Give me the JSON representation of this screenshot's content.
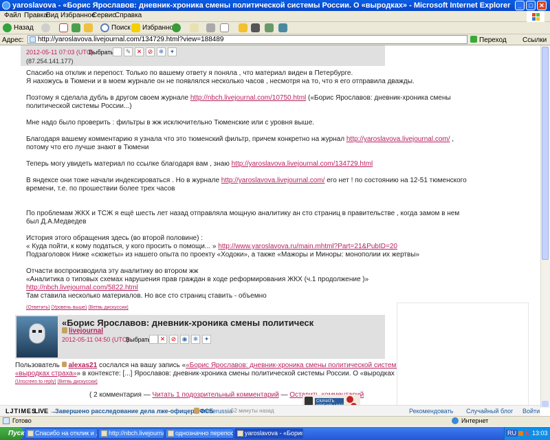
{
  "window": {
    "title": "yaroslavova - «Борис Ярославов: дневник-хроника смены политической системы России. О «выродках» - Microsoft Internet Explorer"
  },
  "menu": [
    "Файл",
    "Правка",
    "Вид",
    "Избранное",
    "Сервис",
    "Справка"
  ],
  "toolbar": {
    "back": "Назад",
    "search": "Поиск",
    "favorites": "Избранное"
  },
  "address": {
    "label": "Адрес:",
    "url": "http://yaroslavova.livejournal.com/134729.html?view=188489",
    "go": "Переход",
    "links": "Ссылки"
  },
  "comment1": {
    "date": "2012-05-11 07:03 (UTC)",
    "select_label": "Выбрать:",
    "ip": "(87.254.141.177)",
    "lines": [
      "Спасибо на отклик и перепост. Только по вашему ответу я поняла , что материал виден в Петербурге.",
      "Я нахожусь в Тюмени и в моем журнале он не появлялся несколько часов , несмотря на то, что я его отправила дважды.",
      "",
      "Поэтому я сделала дубль в другом своем журнале",
      "политической системы России...)",
      "",
      "Мне надо было проверить : фильтры в жж исключительно Тюменские или с уровня выше.",
      "",
      "Благодаря вашему комментарию я узнала что это тюменский фильтр, причем конкретно на журнал",
      "потому что его лучше знают в Тюмени",
      "",
      "Теперь могу увидеть материал по ссылке благодаря вам , знаю",
      "",
      "В яндексе они тоже начали индексироваться . Но в журнале",
      "времени, т.е. по прошествии более трех часов",
      "",
      "",
      "По проблемам ЖКХ и ТСЖ я ещё шесть лет назад отправляла мощную аналитику ан сто страниц в правительстве , когда замом в нем",
      "был Д.А.Медведев",
      "",
      "История этого обращения здесь (во второй половине) :",
      "« Куда пойти, к кому податься, у кого просить о помощи... »",
      "Подзаголовок Ниже «сюжеты» из нашего опыта по проекту «Ходоки», а также «Мажоры и Миноры: монополии их жертвы»",
      "",
      "Отчасти воспроизводила эту аналитику во втором жж",
      "«Аналитика о типовых схемах нарушения прав граждан в ходе реформирования ЖКХ (ч.1 продолжение )»",
      "",
      "Там ставила несколько материалов. Но все сто страниц ставить - объемно"
    ],
    "link_nbch": "http://nbch.livejournal.com/10750.html",
    "after_nbch": "(«Борис Ярославов: дневник-хроника смены",
    "link_yar": "http://yaroslavova.livejournal.com/",
    "after_yar": ",",
    "link_134729": "http://yaroslavova.livejournal.com/134729.html",
    "link_yar2": "http://yaroslavova.livejournal.com/",
    "after_yar2": "его нет ! по состоянию на 12-51 тюменского",
    "link_main": "http://www.yaroslavova.ru/main.mhtml?Part=21&PubID=20",
    "link_5822": "http://nbch.livejournal.com/5822.html",
    "actions": [
      "(Ответить)",
      "(Уровень выше)",
      "(Ветвь дискуссии)"
    ]
  },
  "comment2": {
    "title": "«Борис Ярославов: дневник-хроника смены политическ",
    "author": "livejournal",
    "date": "2012-05-11 04:50 (UTC)",
    "select_label": "Выбрать:",
    "text_a": "Пользователь",
    "user": "alexas21",
    "text_b": "сослался на вашу запись «",
    "ref_link": "«Борис Ярославов: дневник-хроника смены политической системы России. О",
    "ref_link2": "«выродках страха»",
    "text_c": "» в контексте: [...] Ярославов: дневник-хроника смены политической системы России. О «выродках страха», [...]",
    "actions": [
      "(Unscreen to reply)",
      "(Ветвь дискуссии)"
    ]
  },
  "footer": {
    "count": "( 2 комментария —",
    "read_link": "Читать 1 подозрительный комментарий",
    "dash": "—",
    "leave_link": "Оставить комментарий"
  },
  "ticker": {
    "brand": "LJTIMES",
    "live": "LIVE →",
    "headline": "Завершено расследование дела лже-офицера ФСБ",
    "user": "crimerussia",
    "ago": "52 минуты назад",
    "recommended": "Рекомендовать",
    "random": "Случайный блог",
    "login": "Войти"
  },
  "ad": {
    "label": "СКАЧАТЬ МОБИЛЬНУЮ"
  },
  "status": {
    "left": "Готово",
    "zone": "Интернет"
  },
  "taskbar": {
    "start": "Пуск",
    "tasks": [
      "Спасибо на отклик и ...",
      "http://nbch.livejournal.c...",
      "однозначно перепост в ...",
      "yaroslavova - «Борис..."
    ],
    "lang": "RU",
    "time": "13:03"
  }
}
